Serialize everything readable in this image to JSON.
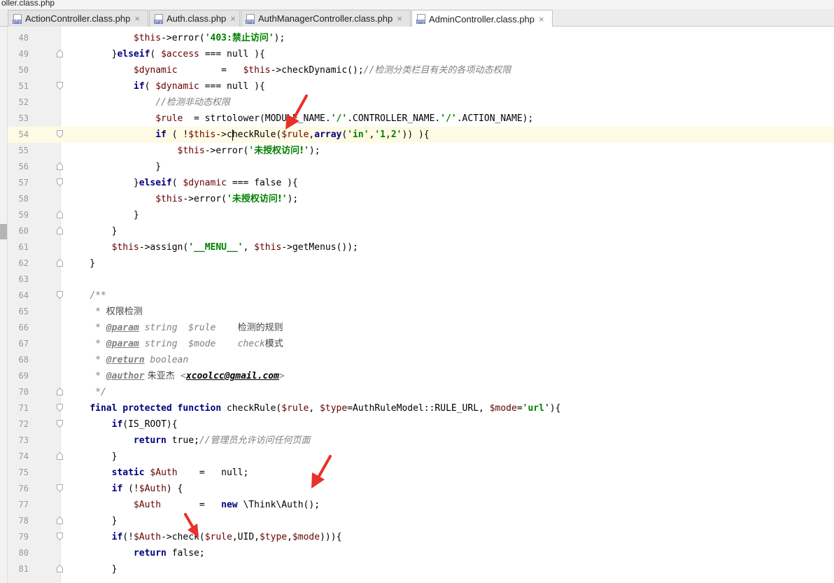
{
  "breadcrumb": "oller.class.php",
  "tabs": [
    {
      "label": "ActionController.class.php",
      "icon": "php"
    },
    {
      "label": "Auth.class.php",
      "icon": "php"
    },
    {
      "label": "AuthManagerController.class.php",
      "icon": "php"
    },
    {
      "label": "AdminController.class.php",
      "icon": "php",
      "active": true
    }
  ],
  "tab_close": "×",
  "current_line": 54,
  "lines": [
    {
      "n": 48,
      "tokens": [
        [
          "",
          "            "
        ],
        [
          "v",
          "$this"
        ],
        [
          "",
          "->error("
        ],
        [
          "s",
          "'403:"
        ],
        [
          "s cjk",
          "禁止访问"
        ],
        [
          "s",
          "'"
        ],
        [
          "",
          ");"
        ]
      ]
    },
    {
      "n": 49,
      "fold": "end",
      "tokens": [
        [
          "",
          "        }"
        ],
        [
          "k",
          "elseif"
        ],
        [
          "",
          "( "
        ],
        [
          "v",
          "$access"
        ],
        [
          "",
          " === null ){"
        ]
      ]
    },
    {
      "n": 50,
      "tokens": [
        [
          "",
          "            "
        ],
        [
          "v",
          "$dynamic"
        ],
        [
          "",
          "        =   "
        ],
        [
          "v",
          "$this"
        ],
        [
          "",
          "->checkDynamic();"
        ],
        [
          "c",
          "//"
        ],
        [
          "c cjk",
          "检测分类栏目有关的各项动态权限"
        ]
      ]
    },
    {
      "n": 51,
      "fold": "start",
      "tokens": [
        [
          "",
          "            "
        ],
        [
          "k",
          "if"
        ],
        [
          "",
          "( "
        ],
        [
          "v",
          "$dynamic"
        ],
        [
          "",
          " === null ){"
        ]
      ]
    },
    {
      "n": 52,
      "tokens": [
        [
          "",
          "                "
        ],
        [
          "c",
          "//"
        ],
        [
          "c cjk",
          "检测非动态权限"
        ]
      ]
    },
    {
      "n": 53,
      "tokens": [
        [
          "",
          "                "
        ],
        [
          "v",
          "$rule"
        ],
        [
          "",
          "  = strtolower(MODULE_NAME."
        ],
        [
          "s",
          "'/'"
        ],
        [
          "",
          ".CONTROLLER_NAME."
        ],
        [
          "s",
          "'/'"
        ],
        [
          "",
          ".ACTION_NAME);"
        ]
      ]
    },
    {
      "n": 54,
      "fold": "start",
      "tokens": [
        [
          "",
          "                "
        ],
        [
          "k",
          "if"
        ],
        [
          "",
          " ( !"
        ],
        [
          "v",
          "$this"
        ],
        [
          "",
          "->c"
        ],
        [
          "caret",
          ""
        ],
        [
          "",
          "heckRule("
        ],
        [
          "v",
          "$rule"
        ],
        [
          "",
          ","
        ],
        [
          "k",
          "array"
        ],
        [
          "",
          "("
        ],
        [
          "s",
          "'in'"
        ],
        [
          "",
          ","
        ],
        [
          "s",
          "'1,2'"
        ],
        [
          "",
          ")) ){"
        ]
      ]
    },
    {
      "n": 55,
      "tokens": [
        [
          "",
          "                    "
        ],
        [
          "v",
          "$this"
        ],
        [
          "",
          "->error("
        ],
        [
          "s",
          "'"
        ],
        [
          "s cjk",
          "未授权访问!"
        ],
        [
          "s",
          "'"
        ],
        [
          "",
          ");"
        ]
      ]
    },
    {
      "n": 56,
      "fold": "end",
      "tokens": [
        [
          "",
          "                }"
        ]
      ]
    },
    {
      "n": 57,
      "fold": "start",
      "tokens": [
        [
          "",
          "            }"
        ],
        [
          "k",
          "elseif"
        ],
        [
          "",
          "( "
        ],
        [
          "v",
          "$dynamic"
        ],
        [
          "",
          " === false ){"
        ]
      ]
    },
    {
      "n": 58,
      "tokens": [
        [
          "",
          "                "
        ],
        [
          "v",
          "$this"
        ],
        [
          "",
          "->error("
        ],
        [
          "s",
          "'"
        ],
        [
          "s cjk",
          "未授权访问!"
        ],
        [
          "s",
          "'"
        ],
        [
          "",
          ");"
        ]
      ]
    },
    {
      "n": 59,
      "fold": "end",
      "tokens": [
        [
          "",
          "            }"
        ]
      ]
    },
    {
      "n": 60,
      "fold": "end",
      "tokens": [
        [
          "",
          "        }"
        ]
      ]
    },
    {
      "n": 61,
      "tokens": [
        [
          "",
          "        "
        ],
        [
          "v",
          "$this"
        ],
        [
          "",
          "->assign("
        ],
        [
          "s",
          "'__MENU__'"
        ],
        [
          "",
          ", "
        ],
        [
          "v",
          "$this"
        ],
        [
          "",
          "->getMenus());"
        ]
      ]
    },
    {
      "n": 62,
      "fold": "end",
      "tokens": [
        [
          "",
          "    }"
        ]
      ]
    },
    {
      "n": 63,
      "tokens": []
    },
    {
      "n": 64,
      "fold": "start",
      "tokens": [
        [
          "",
          "    "
        ],
        [
          "c",
          "/**"
        ]
      ]
    },
    {
      "n": 65,
      "tokens": [
        [
          "",
          "     "
        ],
        [
          "c",
          "* "
        ],
        [
          "ct cjk",
          "权限检测"
        ]
      ]
    },
    {
      "n": 66,
      "tokens": [
        [
          "",
          "     "
        ],
        [
          "c",
          "* "
        ],
        [
          "tg",
          "@param"
        ],
        [
          "c",
          " string  $rule    "
        ],
        [
          "ct cjk",
          "检测的规则"
        ]
      ]
    },
    {
      "n": 67,
      "tokens": [
        [
          "",
          "     "
        ],
        [
          "c",
          "* "
        ],
        [
          "tg",
          "@param"
        ],
        [
          "c",
          " string  $mode    check"
        ],
        [
          "ct cjk",
          "模式"
        ]
      ]
    },
    {
      "n": 68,
      "tokens": [
        [
          "",
          "     "
        ],
        [
          "c",
          "* "
        ],
        [
          "tg",
          "@return"
        ],
        [
          "c",
          " boolean"
        ]
      ]
    },
    {
      "n": 69,
      "tokens": [
        [
          "",
          "     "
        ],
        [
          "c",
          "* "
        ],
        [
          "tg",
          "@author"
        ],
        [
          "ct cjk",
          " 朱亚杰  "
        ],
        [
          "c",
          "<"
        ],
        [
          "ml",
          "xcoolcc@gmail.com"
        ],
        [
          "c",
          ">"
        ]
      ]
    },
    {
      "n": 70,
      "fold": "end",
      "tokens": [
        [
          "",
          "     "
        ],
        [
          "c",
          "*/"
        ]
      ]
    },
    {
      "n": 71,
      "fold": "start",
      "tokens": [
        [
          "",
          "    "
        ],
        [
          "k",
          "final protected function"
        ],
        [
          "",
          " checkRule("
        ],
        [
          "v",
          "$rule"
        ],
        [
          "",
          ", "
        ],
        [
          "v",
          "$type"
        ],
        [
          "",
          "=AuthRuleModel::RULE_URL, "
        ],
        [
          "v",
          "$mode"
        ],
        [
          "",
          "="
        ],
        [
          "s",
          "'url'"
        ],
        [
          "",
          "){"
        ]
      ]
    },
    {
      "n": 72,
      "fold": "start",
      "tokens": [
        [
          "",
          "        "
        ],
        [
          "k",
          "if"
        ],
        [
          "",
          "(IS_ROOT){"
        ]
      ]
    },
    {
      "n": 73,
      "tokens": [
        [
          "",
          "            "
        ],
        [
          "k",
          "return"
        ],
        [
          "",
          " true;"
        ],
        [
          "c",
          "//"
        ],
        [
          "c cjk",
          "管理员允许访问任何页面"
        ]
      ]
    },
    {
      "n": 74,
      "fold": "end",
      "tokens": [
        [
          "",
          "        }"
        ]
      ]
    },
    {
      "n": 75,
      "tokens": [
        [
          "",
          "        "
        ],
        [
          "k",
          "static"
        ],
        [
          " ",
          " "
        ],
        [
          "v",
          "$Auth"
        ],
        [
          "",
          "    =   null;"
        ]
      ]
    },
    {
      "n": 76,
      "fold": "start",
      "tokens": [
        [
          "",
          "        "
        ],
        [
          "k",
          "if"
        ],
        [
          "",
          " (!"
        ],
        [
          "v",
          "$Auth"
        ],
        [
          "",
          ") {"
        ]
      ]
    },
    {
      "n": 77,
      "tokens": [
        [
          "",
          "            "
        ],
        [
          "v",
          "$Auth"
        ],
        [
          "",
          "       =   "
        ],
        [
          "k",
          "new"
        ],
        [
          "",
          " \\Think\\Auth();"
        ]
      ]
    },
    {
      "n": 78,
      "fold": "end",
      "tokens": [
        [
          "",
          "        }"
        ]
      ]
    },
    {
      "n": 79,
      "fold": "start",
      "tokens": [
        [
          "",
          "        "
        ],
        [
          "k",
          "if"
        ],
        [
          "",
          "(!"
        ],
        [
          "v",
          "$Auth"
        ],
        [
          "",
          "->check("
        ],
        [
          "v",
          "$rule"
        ],
        [
          "",
          ",UID,"
        ],
        [
          "v",
          "$type"
        ],
        [
          "",
          ","
        ],
        [
          "v",
          "$mode"
        ],
        [
          "",
          "))){"
        ]
      ]
    },
    {
      "n": 80,
      "tokens": [
        [
          "",
          "            "
        ],
        [
          "k",
          "return"
        ],
        [
          "",
          " false;"
        ]
      ]
    },
    {
      "n": 81,
      "fold": "end",
      "tokens": [
        [
          "",
          "        }"
        ]
      ]
    }
  ],
  "annotations": {
    "arrow_color": "#e8312a"
  },
  "colors": {
    "keyword": "#000080",
    "variable": "#660000",
    "string": "#008000",
    "comment": "#808080",
    "current_line": "#fffae3"
  }
}
